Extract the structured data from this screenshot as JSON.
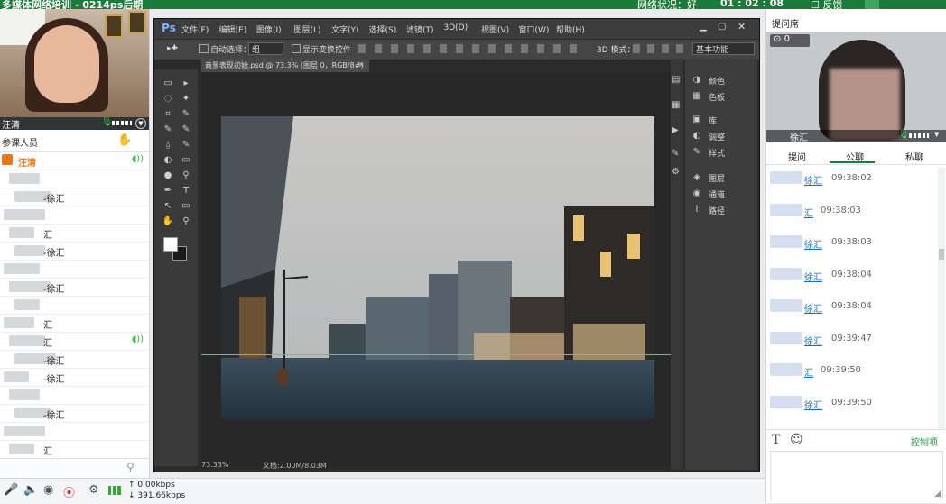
{
  "app": {
    "title": "多媒体网络培训 - 0214ps后期",
    "network": "网络状况：好",
    "timer": "01 : 02 : 08",
    "feedback": "反馈"
  },
  "left_panel": {
    "teacher_name": "汪清",
    "participants_label": "参课人员",
    "rows": [
      {
        "name": "汪清",
        "mic": true,
        "highlight": true
      },
      {
        "name": "",
        "mic": false
      },
      {
        "name": "-徐汇",
        "mic": false
      },
      {
        "name": "",
        "mic": false
      },
      {
        "name": "汇",
        "mic": false
      },
      {
        "name": "-徐汇",
        "mic": false
      },
      {
        "name": "",
        "mic": false
      },
      {
        "name": "-徐汇",
        "mic": false
      },
      {
        "name": "",
        "mic": false
      },
      {
        "name": "汇",
        "mic": false
      },
      {
        "name": "汇",
        "mic": true
      },
      {
        "name": "-徐汇",
        "mic": false
      },
      {
        "name": "-徐汇",
        "mic": false
      },
      {
        "name": "",
        "mic": false
      },
      {
        "name": "-徐汇",
        "mic": false
      },
      {
        "name": "",
        "mic": false
      },
      {
        "name": "汇",
        "mic": false
      }
    ]
  },
  "bottom_bar": {
    "upload": "0.00kbps",
    "download": "391.66kbps"
  },
  "photoshop": {
    "logo": "Ps",
    "menu": [
      "文件(F)",
      "编辑(E)",
      "图像(I)",
      "图层(L)",
      "文字(Y)",
      "选择(S)",
      "滤镜(T)",
      "3D(D)",
      "视图(V)",
      "窗口(W)",
      "帮助(H)"
    ],
    "options": {
      "auto_select": "自动选择：",
      "group_value": "组",
      "transform": "显示变换控件",
      "mode3d": "3D 模式：",
      "workspace": "基本功能"
    },
    "doc_tab": "商景表现初始.psd @ 73.3% (图层 0，RGB/8#)",
    "status_zoom": "73.33%",
    "status_doc": "文档:2.00M/8.03M",
    "panels": [
      "颜色",
      "色板",
      "库",
      "调整",
      "样式",
      "图层",
      "通道",
      "路径"
    ]
  },
  "right_panel": {
    "title": "提问席",
    "count": "0",
    "cam_name": "徐汇",
    "tabs": [
      "提问",
      "公聊",
      "私聊"
    ],
    "active_tab": 1,
    "messages": [
      {
        "name": "徐汇",
        "time": "09:38:02"
      },
      {
        "name": "汇",
        "time": "09:38:03"
      },
      {
        "name": "徐汇",
        "time": "09:38:03"
      },
      {
        "name": "徐汇",
        "time": "09:38:04"
      },
      {
        "name": "徐汇",
        "time": "09:38:04"
      },
      {
        "name": "徐汇",
        "time": "09:39:47"
      },
      {
        "name": "汇",
        "time": "09:39:50"
      },
      {
        "name": "徐汇",
        "time": "09:39:50"
      }
    ],
    "control_label": "控制项"
  },
  "colors": {
    "accent_green": "#1b7b3a",
    "link_blue": "#1a6ebf",
    "highlight_orange": "#e8761b"
  }
}
